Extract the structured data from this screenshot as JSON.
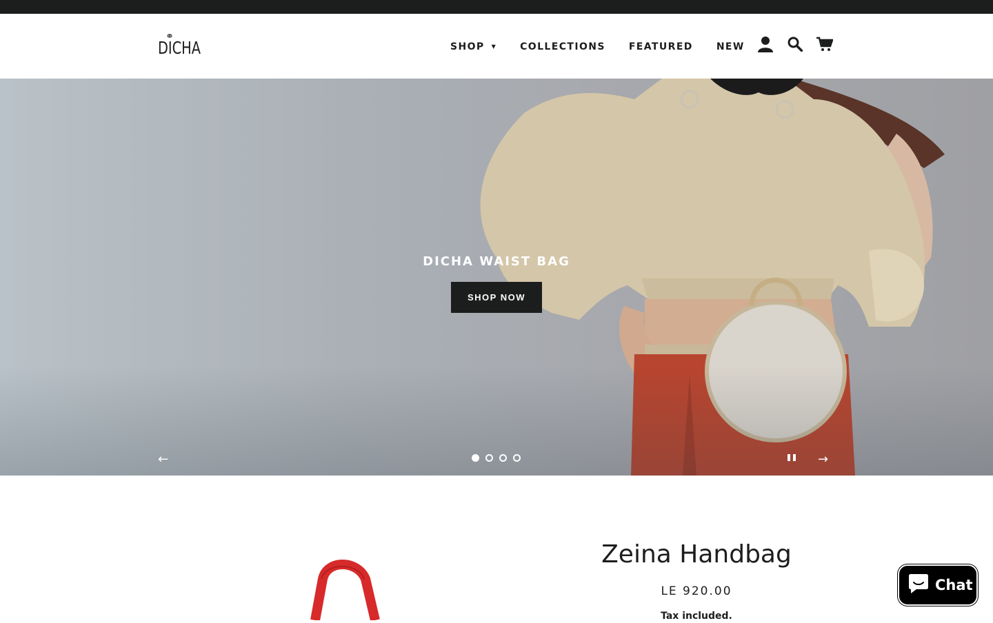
{
  "header": {
    "logo_text": "DICHA",
    "nav": [
      {
        "label": "SHOP",
        "has_dropdown": true
      },
      {
        "label": "COLLECTIONS"
      },
      {
        "label": "FEATURED"
      },
      {
        "label": "NEW"
      }
    ],
    "icons": [
      "account-icon",
      "search-icon",
      "cart-icon"
    ]
  },
  "hero": {
    "title": "DICHA WAIST BAG",
    "button_label": "SHOP NOW",
    "slide_count": 4,
    "active_slide": 1,
    "prev_icon": "←",
    "next_icon": "→"
  },
  "product": {
    "title": "Zeina Handbag",
    "price": "LE 920.00",
    "tax_note": "Tax included."
  },
  "chat": {
    "label": "Chat"
  },
  "colors": {
    "dark": "#1c1d1d",
    "accent_red": "#d72a2a"
  }
}
